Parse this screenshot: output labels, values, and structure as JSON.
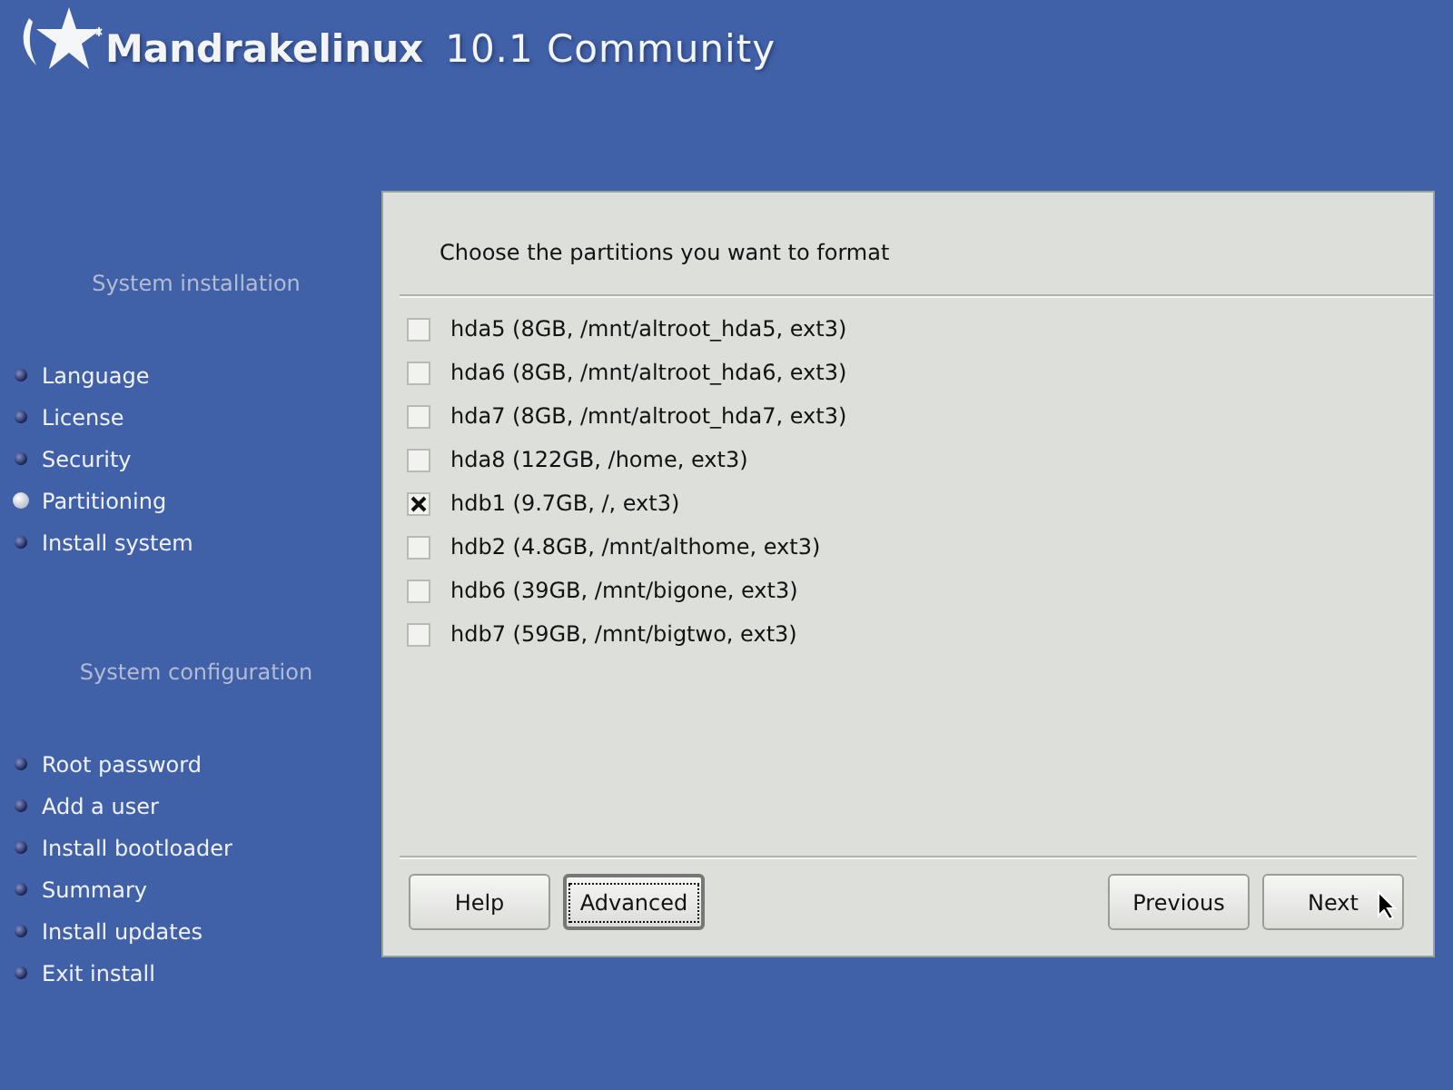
{
  "header": {
    "brand": "Mandrakelinux",
    "edition": "10.1 Community"
  },
  "sidebar": {
    "sections": [
      {
        "title": "System installation",
        "items": [
          {
            "label": "Language",
            "selected": false
          },
          {
            "label": "License",
            "selected": false
          },
          {
            "label": "Security",
            "selected": false
          },
          {
            "label": "Partitioning",
            "selected": true
          },
          {
            "label": "Install system",
            "selected": false
          }
        ]
      },
      {
        "title": "System configuration",
        "items": [
          {
            "label": "Root password",
            "selected": false
          },
          {
            "label": "Add a user",
            "selected": false
          },
          {
            "label": "Install bootloader",
            "selected": false
          },
          {
            "label": "Summary",
            "selected": false
          },
          {
            "label": "Install updates",
            "selected": false
          },
          {
            "label": "Exit install",
            "selected": false
          }
        ]
      }
    ]
  },
  "panel": {
    "prompt": "Choose the partitions you want to format",
    "partitions": [
      {
        "label": "hda5 (8GB, /mnt/altroot_hda5, ext3)",
        "checked": false
      },
      {
        "label": "hda6 (8GB, /mnt/altroot_hda6, ext3)",
        "checked": false
      },
      {
        "label": "hda7 (8GB, /mnt/altroot_hda7, ext3)",
        "checked": false
      },
      {
        "label": "hda8 (122GB, /home, ext3)",
        "checked": false
      },
      {
        "label": "hdb1 (9.7GB, /, ext3)",
        "checked": true
      },
      {
        "label": "hdb2 (4.8GB, /mnt/althome, ext3)",
        "checked": false
      },
      {
        "label": "hdb6 (39GB, /mnt/bigone, ext3)",
        "checked": false
      },
      {
        "label": "hdb7 (59GB, /mnt/bigtwo, ext3)",
        "checked": false
      }
    ],
    "buttons_left": [
      {
        "label": "Help",
        "focused": false
      },
      {
        "label": "Advanced",
        "focused": true
      }
    ],
    "buttons_right": [
      {
        "label": "Previous",
        "focused": false
      },
      {
        "label": "Next",
        "focused": false
      }
    ]
  }
}
